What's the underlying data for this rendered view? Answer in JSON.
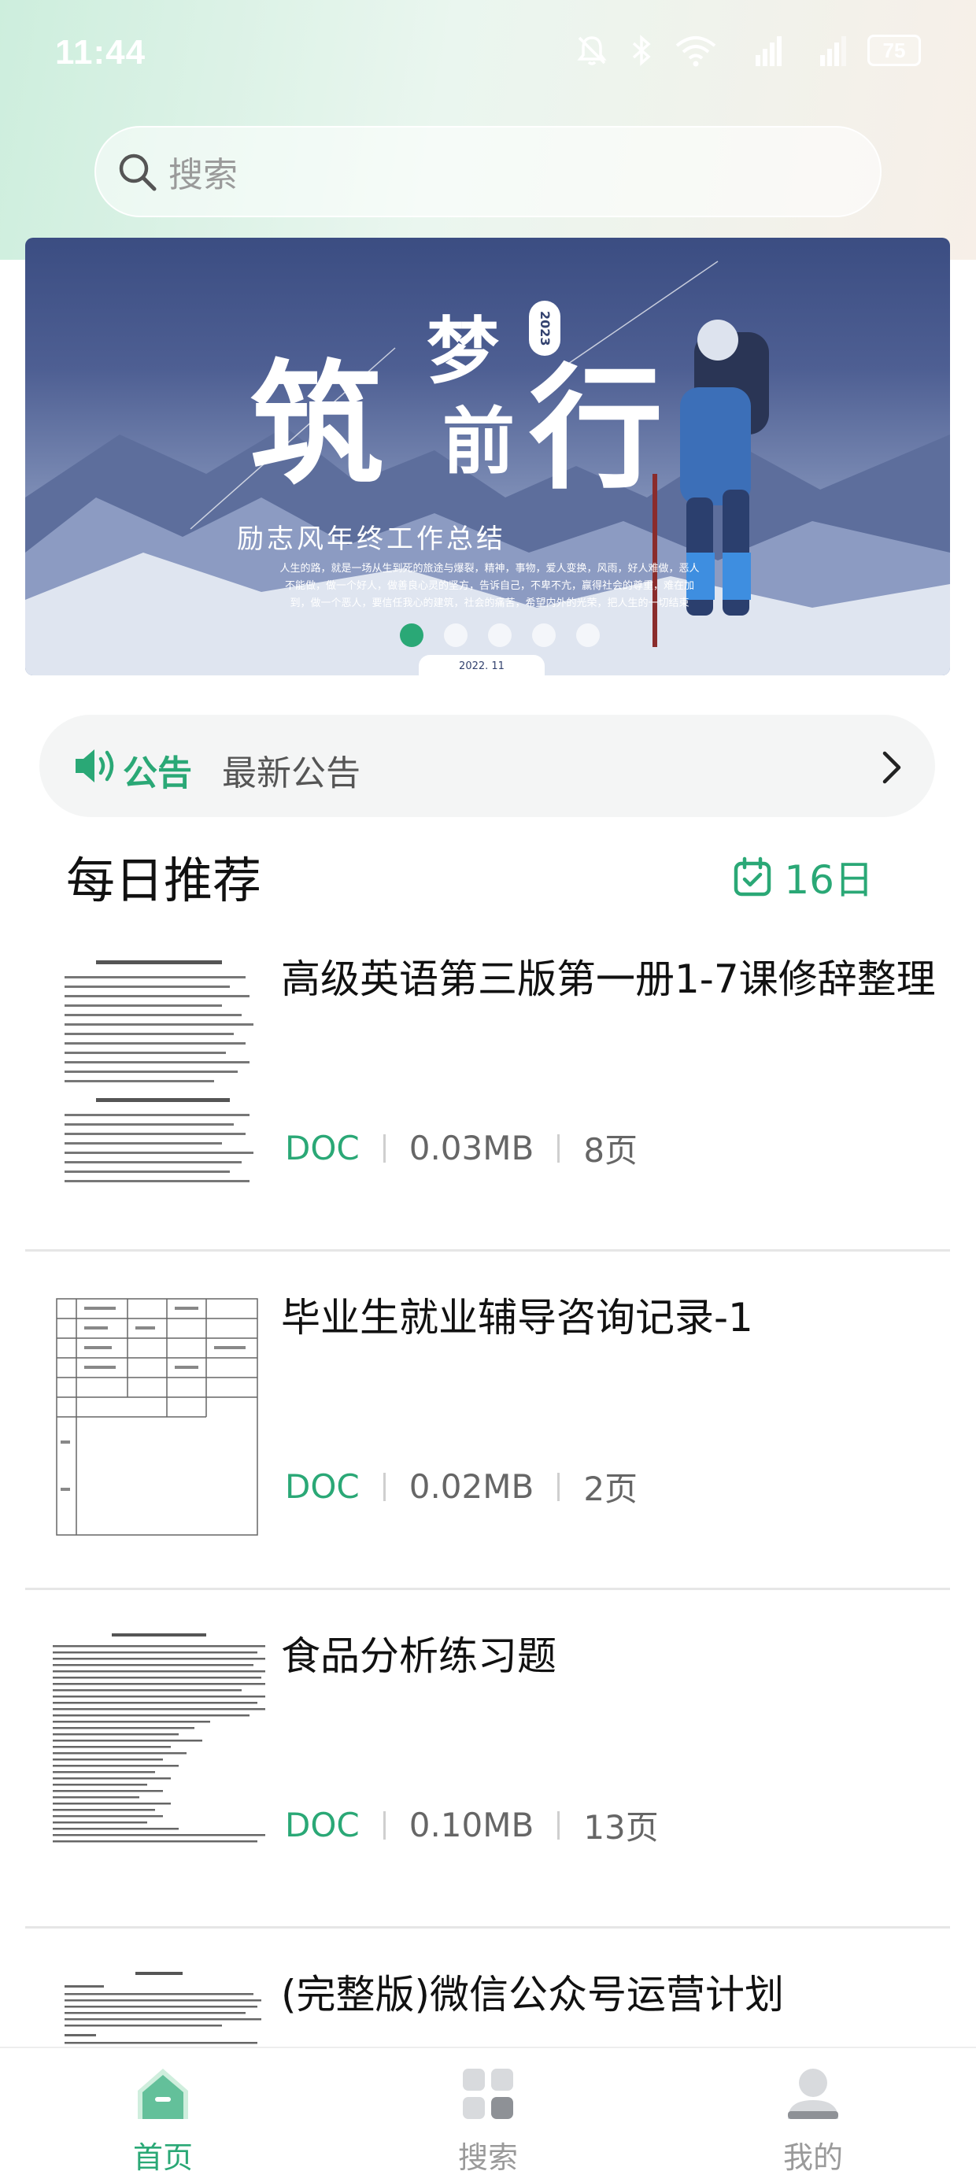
{
  "status_bar": {
    "time": "11:44",
    "battery": "75"
  },
  "search": {
    "placeholder": "搜索"
  },
  "banner": {
    "title_char_1": "筑",
    "title_char_2": "梦",
    "title_char_3": "前",
    "title_char_4": "行",
    "year": "2023",
    "subtitle": "励志风年终工作总结",
    "description": "人生的路，就是一场从生到死的旅途与爆裂，精神，事物，爱人变换，风雨，好人难做，恶人不能做，做一个好人，做善良心灵的坚方，告诉自己，不卑不亢，赢得社会的尊重，难在加到，做一个恶人，要信任我心的建筑，社会的痛苦，希望内外的光荣，把人生的一切结束",
    "date": "2022. 11",
    "dots_count": 5,
    "active_dot": 0
  },
  "notice": {
    "tag": "公告",
    "text": "最新公告"
  },
  "daily": {
    "title": "每日推荐",
    "date": "16日"
  },
  "documents": [
    {
      "title": "高级英语第三版第一册1-7课修辞整理",
      "type": "DOC",
      "size": "0.03MB",
      "pages": "8页"
    },
    {
      "title": "毕业生就业辅导咨询记录-1",
      "type": "DOC",
      "size": "0.02MB",
      "pages": "2页"
    },
    {
      "title": "食品分析练习题",
      "type": "DOC",
      "size": "0.10MB",
      "pages": "13页"
    },
    {
      "title": "(完整版)微信公众号运营计划",
      "type": "",
      "size": "",
      "pages": ""
    }
  ],
  "tabbar": {
    "items": [
      {
        "label": "首页",
        "icon": "home-icon",
        "active": true
      },
      {
        "label": "搜索",
        "icon": "grid-icon",
        "active": false
      },
      {
        "label": "我的",
        "icon": "user-icon",
        "active": false
      }
    ]
  },
  "colors": {
    "accent": "#2aa876",
    "muted": "#9a9a9a"
  }
}
